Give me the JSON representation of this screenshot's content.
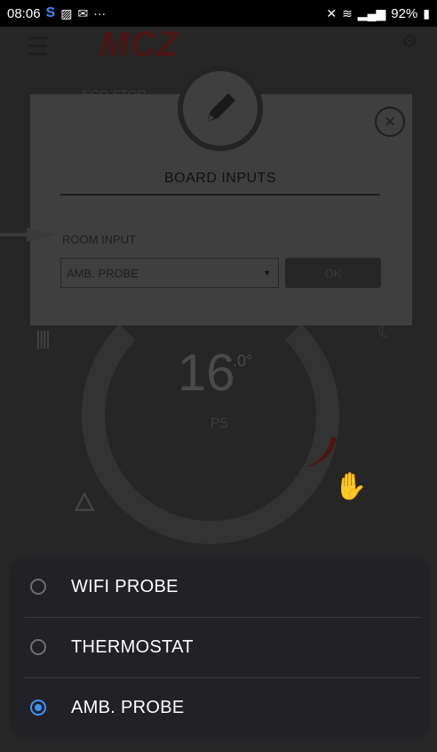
{
  "status_bar": {
    "time": "08:06",
    "battery": "92%"
  },
  "app": {
    "logo": "MCZ",
    "background_label": "ECO STOP",
    "temperature_integer": "16",
    "temperature_decimal": ".0°",
    "power_level": "P5"
  },
  "dialog": {
    "title": "BOARD INPUTS",
    "room_input_label": "ROOM INPUT",
    "room_input_value": "AMB. PROBE",
    "ok_label": "OK"
  },
  "sheet": {
    "options": [
      {
        "label": "WIFI PROBE",
        "selected": false
      },
      {
        "label": "THERMOSTAT",
        "selected": false
      },
      {
        "label": "AMB. PROBE",
        "selected": true
      }
    ]
  },
  "colors": {
    "accent": "#3e93ff",
    "dialog_bg": "#3f3f3f",
    "sheet_bg": "#222226"
  }
}
